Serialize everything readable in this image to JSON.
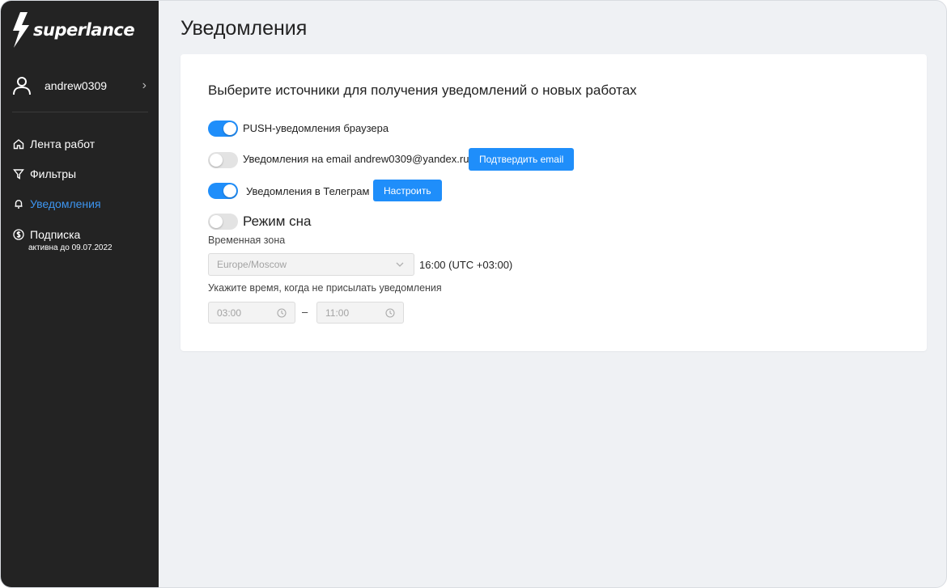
{
  "app": {
    "logo_text": "superlance"
  },
  "sidebar": {
    "username": "andrew0309",
    "nav": [
      {
        "label": "Лента работ",
        "icon": "home-icon"
      },
      {
        "label": "Фильтры",
        "icon": "filter-icon"
      },
      {
        "label": "Уведомления",
        "icon": "bell-icon",
        "active": true
      },
      {
        "label": "Подписка",
        "icon": "dollar-icon",
        "sub": "активна до 09.07.2022"
      }
    ]
  },
  "page": {
    "title": "Уведомления"
  },
  "notifications": {
    "heading": "Выберите источники для получения уведомлений о новых работах",
    "push": {
      "label": "PUSH-уведомления браузера",
      "enabled": true
    },
    "email": {
      "label": "Уведомления на email andrew0309@yandex.ru",
      "enabled": false,
      "button": "Подтвердить email"
    },
    "telegram": {
      "label": "Уведомления в Телеграм",
      "enabled": true,
      "button": "Настроить"
    },
    "sleep": {
      "label": "Режим сна",
      "enabled": false
    },
    "timezone": {
      "label": "Временная зона",
      "value": "Europe/Moscow",
      "current_time": "16:00 (UTC +03:00)"
    },
    "quiet_hours": {
      "label": "Укажите время, когда не присылать уведомления",
      "from": "03:00",
      "to": "11:00",
      "separator": "–"
    }
  },
  "colors": {
    "accent": "#1f8efa",
    "sidebar_bg": "#232323",
    "active_nav": "#3d95f0",
    "page_bg": "#eff1f4"
  }
}
